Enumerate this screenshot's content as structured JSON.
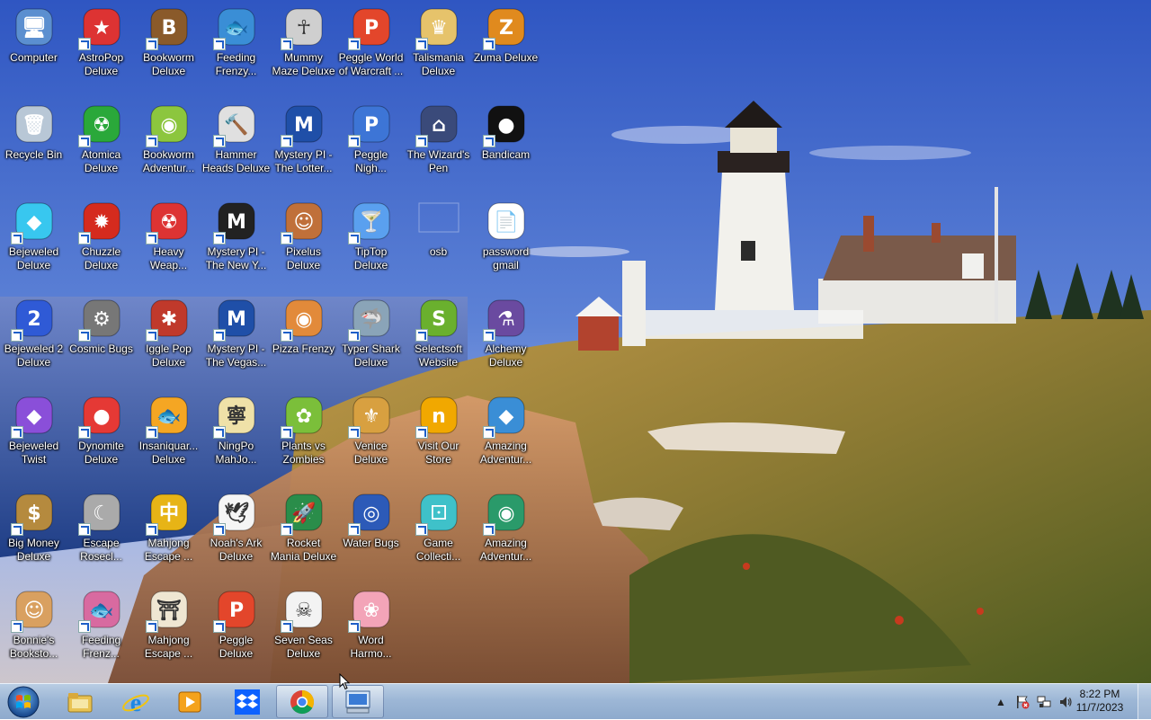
{
  "desktop": {
    "icons": [
      {
        "label": "Computer",
        "icon": "computer-icon",
        "shortcut": false
      },
      {
        "label": "AstroPop\nDeluxe",
        "icon": "astropop-icon",
        "shortcut": true
      },
      {
        "label": "Bookworm\nDeluxe",
        "icon": "bookworm-icon",
        "shortcut": true
      },
      {
        "label": "Feeding\nFrenzy...",
        "icon": "feeding-frenzy-icon",
        "shortcut": true
      },
      {
        "label": "Mummy\nMaze Deluxe",
        "icon": "mummy-maze-icon",
        "shortcut": true
      },
      {
        "label": "Peggle World\nof Warcraft ...",
        "icon": "peggle-wow-icon",
        "shortcut": true
      },
      {
        "label": "Talismania\nDeluxe",
        "icon": "talismania-icon",
        "shortcut": true
      },
      {
        "label": "Zuma Deluxe",
        "icon": "zuma-icon",
        "shortcut": true
      },
      {
        "label": "Recycle Bin",
        "icon": "recycle-bin-icon",
        "shortcut": false
      },
      {
        "label": "Atomica\nDeluxe",
        "icon": "atomica-icon",
        "shortcut": true
      },
      {
        "label": "Bookworm\nAdventur...",
        "icon": "bookworm-adventures-icon",
        "shortcut": true
      },
      {
        "label": "Hammer\nHeads Deluxe",
        "icon": "hammer-heads-icon",
        "shortcut": true
      },
      {
        "label": "Mystery PI -\nThe Lotter...",
        "icon": "mystery-pi-lottery-icon",
        "shortcut": true
      },
      {
        "label": "Peggle\nNigh...",
        "icon": "peggle-nights-icon",
        "shortcut": true
      },
      {
        "label": "The Wizard's\nPen",
        "icon": "wizards-pen-icon",
        "shortcut": true
      },
      {
        "label": "Bandicam",
        "icon": "bandicam-icon",
        "shortcut": true
      },
      {
        "label": "Bejeweled\nDeluxe",
        "icon": "bejeweled-icon",
        "shortcut": true
      },
      {
        "label": "Chuzzle\nDeluxe",
        "icon": "chuzzle-icon",
        "shortcut": true
      },
      {
        "label": "Heavy\nWeap...",
        "icon": "heavy-weapon-icon",
        "shortcut": true
      },
      {
        "label": "Mystery PI -\nThe New Y...",
        "icon": "mystery-pi-new-york-icon",
        "shortcut": true
      },
      {
        "label": "Pixelus\nDeluxe",
        "icon": "pixelus-icon",
        "shortcut": true
      },
      {
        "label": "TipTop\nDeluxe",
        "icon": "tiptop-icon",
        "shortcut": true
      },
      {
        "label": "osb",
        "icon": "osb-icon",
        "shortcut": false
      },
      {
        "label": "password\ngmail",
        "icon": "text-document-icon",
        "shortcut": false
      },
      {
        "label": "Bejeweled 2\nDeluxe",
        "icon": "bejeweled-2-icon",
        "shortcut": true
      },
      {
        "label": "Cosmic Bugs",
        "icon": "cosmic-bugs-icon",
        "shortcut": true
      },
      {
        "label": "Iggle Pop\nDeluxe",
        "icon": "iggle-pop-icon",
        "shortcut": true
      },
      {
        "label": "Mystery PI -\nThe Vegas...",
        "icon": "mystery-pi-vegas-icon",
        "shortcut": true
      },
      {
        "label": "Pizza Frenzy",
        "icon": "pizza-frenzy-icon",
        "shortcut": true
      },
      {
        "label": "Typer Shark\nDeluxe",
        "icon": "typer-shark-icon",
        "shortcut": true
      },
      {
        "label": "Selectsoft\nWebsite",
        "icon": "selectsoft-icon",
        "shortcut": true
      },
      {
        "label": "Alchemy\nDeluxe",
        "icon": "alchemy-icon",
        "shortcut": true
      },
      {
        "label": "Bejeweled\nTwist",
        "icon": "bejeweled-twist-icon",
        "shortcut": true
      },
      {
        "label": "Dynomite\nDeluxe",
        "icon": "dynomite-icon",
        "shortcut": true
      },
      {
        "label": "Insaniquar...\nDeluxe",
        "icon": "insaniquarium-icon",
        "shortcut": true
      },
      {
        "label": "NingPo\nMahJo...",
        "icon": "ningpo-mahjong-icon",
        "shortcut": true
      },
      {
        "label": "Plants vs\nZombies",
        "icon": "plants-vs-zombies-icon",
        "shortcut": true
      },
      {
        "label": "Venice\nDeluxe",
        "icon": "venice-icon",
        "shortcut": true
      },
      {
        "label": "Visit Our\nStore",
        "icon": "store-icon",
        "shortcut": true
      },
      {
        "label": "Amazing\nAdventur...",
        "icon": "amazing-adventures-icon",
        "shortcut": true
      },
      {
        "label": "Big Money\nDeluxe",
        "icon": "big-money-icon",
        "shortcut": true
      },
      {
        "label": "Escape\nRosecl...",
        "icon": "escape-rosecliff-icon",
        "shortcut": true
      },
      {
        "label": "Mahjong\nEscape ...",
        "icon": "mahjong-escape-icon",
        "shortcut": true
      },
      {
        "label": "Noah's Ark\nDeluxe",
        "icon": "noahs-ark-icon",
        "shortcut": true
      },
      {
        "label": "Rocket\nMania Deluxe",
        "icon": "rocket-mania-icon",
        "shortcut": true
      },
      {
        "label": "Water Bugs",
        "icon": "water-bugs-icon",
        "shortcut": true
      },
      {
        "label": "Game\nCollecti...",
        "icon": "game-collection-icon",
        "shortcut": true
      },
      {
        "label": "Amazing\nAdventur...",
        "icon": "amazing-adventures-2-icon",
        "shortcut": true
      },
      {
        "label": "Bonnie's\nBooksto...",
        "icon": "bonnies-bookstore-icon",
        "shortcut": true
      },
      {
        "label": "Feeding\nFrenz...",
        "icon": "feeding-frenzy-2-icon",
        "shortcut": true
      },
      {
        "label": "Mahjong\nEscape ...",
        "icon": "mahjong-escape-2-icon",
        "shortcut": true
      },
      {
        "label": "Peggle\nDeluxe",
        "icon": "peggle-deluxe-icon",
        "shortcut": true
      },
      {
        "label": "Seven Seas\nDeluxe",
        "icon": "seven-seas-icon",
        "shortcut": true
      },
      {
        "label": "Word\nHarmo...",
        "icon": "word-harmony-icon",
        "shortcut": true
      }
    ]
  },
  "taskbar": {
    "start": "windows-start-icon",
    "buttons": [
      {
        "name": "file-explorer-icon",
        "active": false
      },
      {
        "name": "internet-explorer-icon",
        "active": false
      },
      {
        "name": "media-player-icon",
        "active": false
      },
      {
        "name": "dropbox-icon",
        "active": false
      },
      {
        "name": "chrome-icon",
        "active": true
      },
      {
        "name": "remote-desktop-icon",
        "active": true
      }
    ],
    "tray": {
      "icons": [
        "show-hidden-icons-icon",
        "action-center-flag-icon",
        "network-icon",
        "volume-icon"
      ],
      "time": "8:22 PM",
      "date": "11/7/2023"
    }
  },
  "colors": {
    "sky_top": "#3a5fc0",
    "sky_bottom": "#9bb4e6",
    "sea": "#2e4f9a",
    "grass": "#8a7a30",
    "lighthouse": "#f2f1ec",
    "taskbar": "#a7bfdc"
  }
}
